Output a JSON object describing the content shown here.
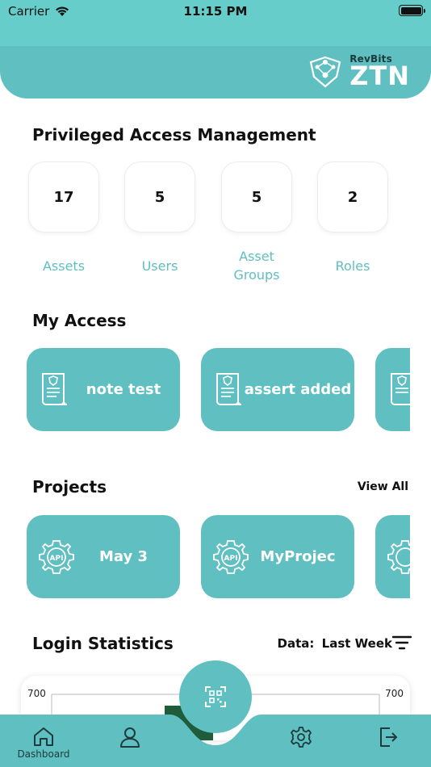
{
  "status_bar": {
    "carrier": "Carrier",
    "time": "11:15 PM"
  },
  "header": {
    "brand_rev": "Rev",
    "brand_bits": "Bits",
    "product": "ZTN"
  },
  "pam": {
    "title": "Privileged Access Management",
    "stats": [
      {
        "value": "17",
        "label": "Assets"
      },
      {
        "value": "5",
        "label": "Users"
      },
      {
        "value": "5",
        "label": "Asset Groups"
      },
      {
        "value": "2",
        "label": "Roles"
      }
    ]
  },
  "my_access": {
    "title": "My Access",
    "items": [
      {
        "label": "note test",
        "icon": "document-certificate-icon"
      },
      {
        "label": "assert added",
        "icon": "document-certificate-icon"
      },
      {
        "label": "",
        "icon": "document-certificate-icon"
      }
    ]
  },
  "projects": {
    "title": "Projects",
    "view_all": "View All",
    "items": [
      {
        "label": "May 3",
        "icon": "api-gear-icon"
      },
      {
        "label": "MyProjec",
        "icon": "api-gear-icon"
      },
      {
        "label": "",
        "icon": "api-gear-icon"
      }
    ]
  },
  "login_stats": {
    "title": "Login Statistics",
    "filter_prefix": "Data:",
    "filter_value": "Last Week"
  },
  "chart_data": {
    "type": "bar",
    "title": "",
    "ylim": [
      0,
      700
    ],
    "y_tick_left": "700",
    "y_tick_right": "700",
    "colors": [
      "#1f5c3c"
    ]
  },
  "tab_bar": {
    "items": [
      {
        "label": "Dashboard",
        "icon": "home-icon"
      },
      {
        "label": "",
        "icon": "user-icon"
      },
      {
        "label": "",
        "icon": "qr-scan-icon"
      },
      {
        "label": "",
        "icon": "gear-icon"
      },
      {
        "label": "",
        "icon": "logout-icon"
      }
    ]
  },
  "colors": {
    "accent": "#5fbfc1",
    "status_bar": "#66cdca",
    "text_dark": "#1d3b3c"
  }
}
